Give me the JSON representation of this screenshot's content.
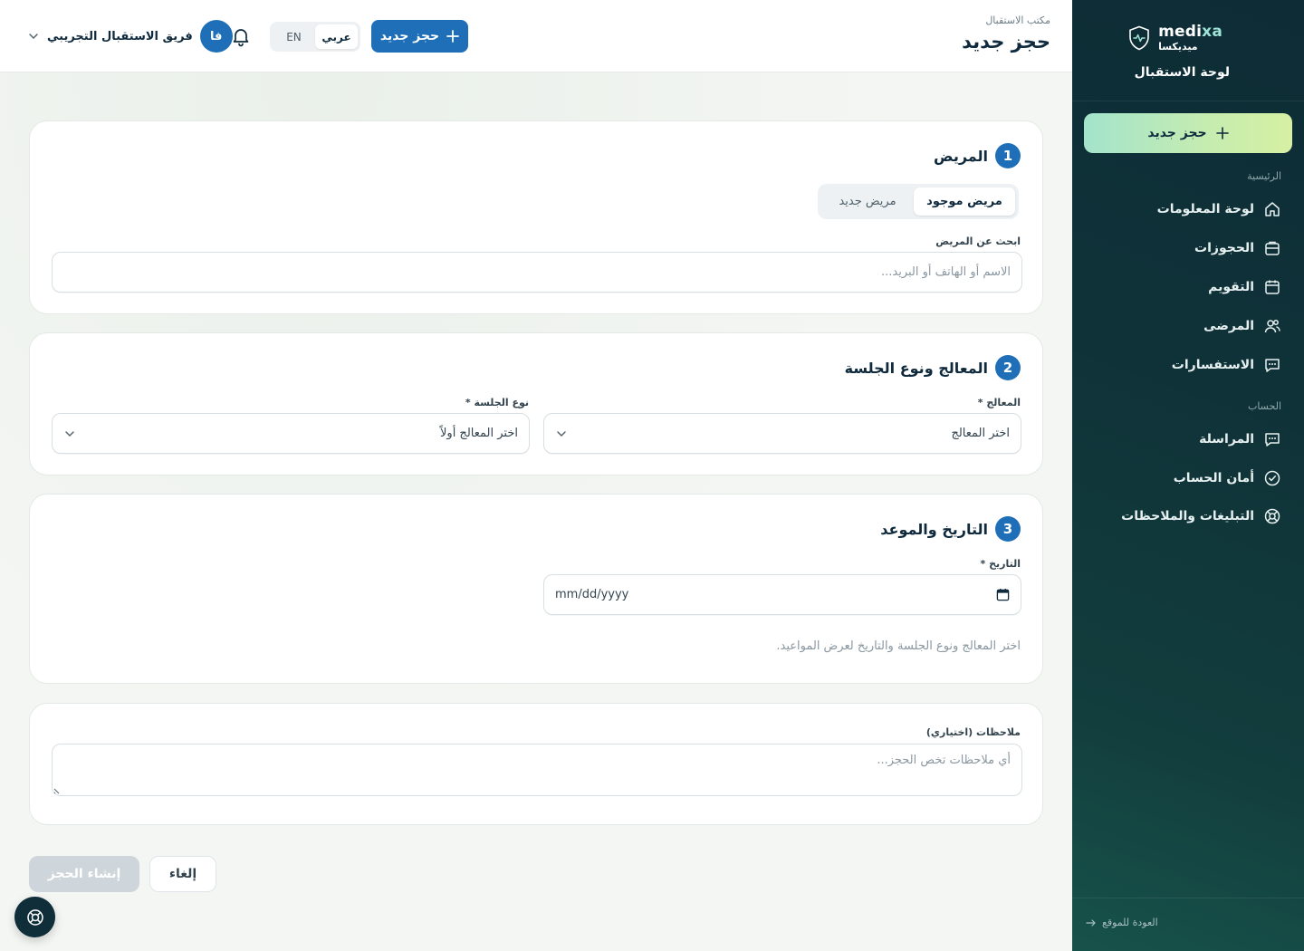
{
  "brand": {
    "name_en_main": "medi",
    "name_en_accent": "xa",
    "name_ar": "ميديكسا",
    "panel_title": "لوحة الاستقبال"
  },
  "sidebar": {
    "cta_label": "حجز جديد",
    "section_main": "الرئيسية",
    "section_account": "الحساب",
    "items": [
      {
        "label": "لوحة المعلومات",
        "icon": "home-icon"
      },
      {
        "label": "الحجوزات",
        "icon": "briefcase-icon"
      },
      {
        "label": "التقويم",
        "icon": "calendar-icon"
      },
      {
        "label": "المرضى",
        "icon": "users-icon"
      },
      {
        "label": "الاستفسارات",
        "icon": "chat-icon"
      },
      {
        "label": "المراسلة",
        "icon": "message-icon"
      },
      {
        "label": "أمان الحساب",
        "icon": "check-circle-icon"
      },
      {
        "label": "التبليغات والملاحظات",
        "icon": "lifebuoy-icon"
      }
    ],
    "back_link": "العودة للموقع"
  },
  "header": {
    "breadcrumb": "مكتب الاستقبال",
    "title": "حجز جديد",
    "cta_label": "حجز جديد",
    "lang_ar": "عربي",
    "lang_en": "EN",
    "user_initials": "فا",
    "user_name": "فريق الاستقبال التجريبي"
  },
  "patient_card": {
    "step": "1",
    "title": "المريض",
    "tab_existing": "مريض موجود",
    "tab_new": "مريض جديد",
    "search_label": "ابحث عن المريض",
    "search_placeholder": "الاسم أو الهاتف أو البريد..."
  },
  "therapist_card": {
    "step": "2",
    "title": "المعالج ونوع الجلسة",
    "therapist_label": "المعالج *",
    "therapist_value": "اختر المعالج",
    "session_label": "نوع الجلسة *",
    "session_value": "اختر المعالج أولاً"
  },
  "date_card": {
    "step": "3",
    "title": "التاريخ والموعد",
    "date_label": "التاريخ *",
    "date_placeholder": "mm/dd/yyyy",
    "hint": "اختر المعالج ونوع الجلسة والتاريخ لعرض المواعيد."
  },
  "notes_card": {
    "label": "ملاحظات (اختياري)",
    "placeholder": "أي ملاحظات تخص الحجز..."
  },
  "actions": {
    "create": "إنشاء الحجز",
    "cancel": "إلغاء"
  },
  "colors": {
    "primary": "#1f6fb8",
    "sidebar_dark": "#0f2e39",
    "cta_green": "#c6ecb0"
  }
}
